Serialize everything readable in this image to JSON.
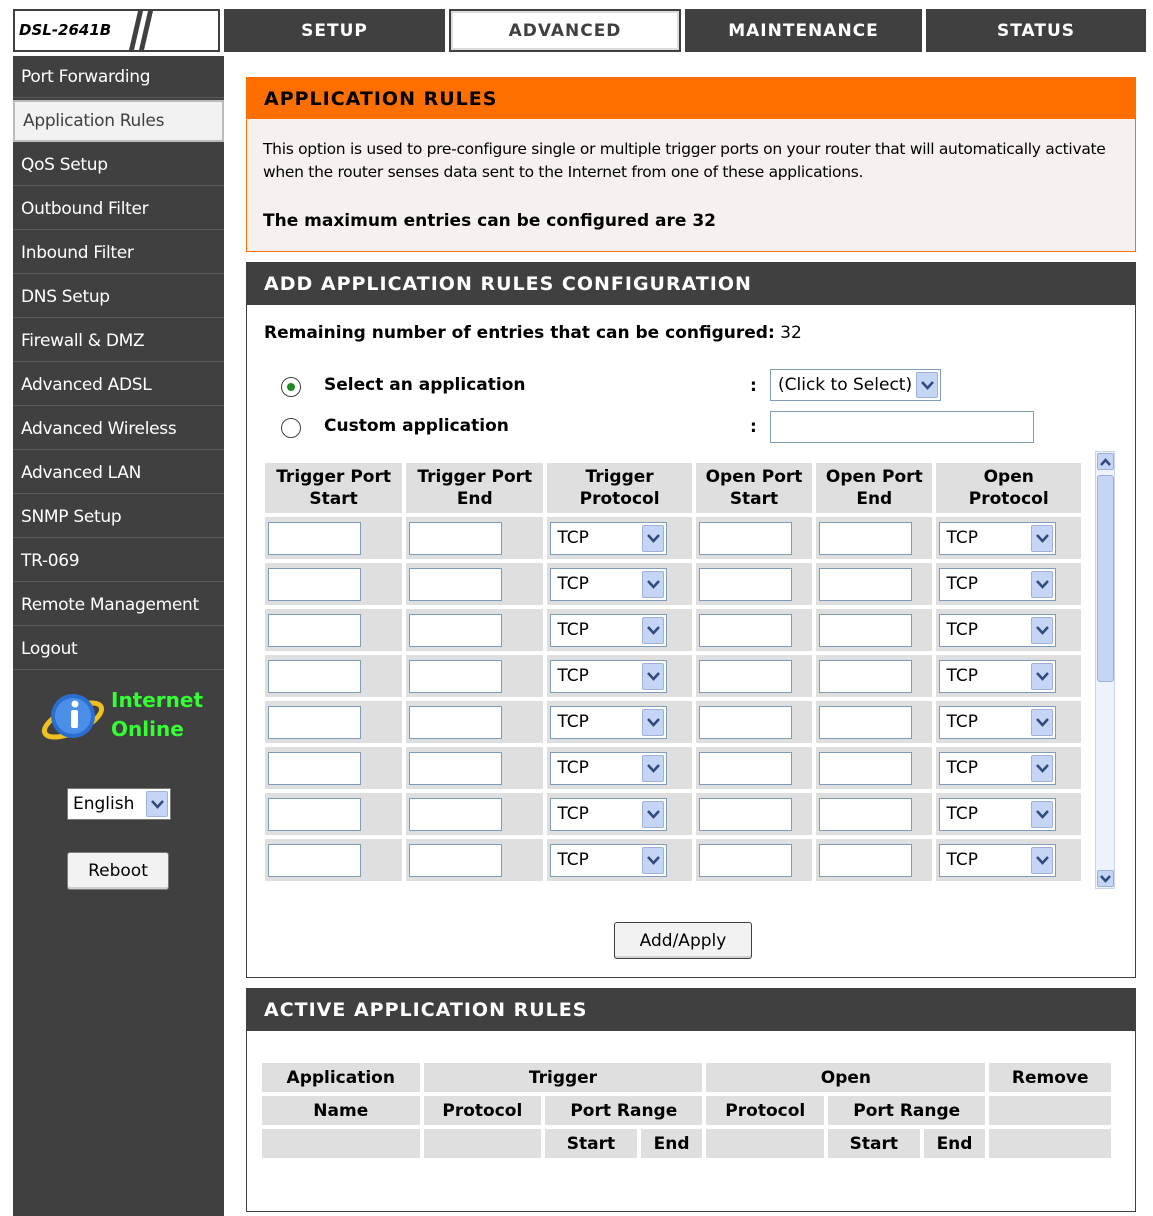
{
  "model": "DSL-2641B",
  "tabs": [
    "SETUP",
    "ADVANCED",
    "MAINTENANCE",
    "STATUS"
  ],
  "active_tab": "ADVANCED",
  "sidebar": {
    "items": [
      "Port Forwarding",
      "Application Rules",
      "QoS Setup",
      "Outbound Filter",
      "Inbound Filter",
      "DNS Setup",
      "Firewall & DMZ",
      "Advanced ADSL",
      "Advanced Wireless",
      "Advanced LAN",
      "SNMP Setup",
      "TR-069",
      "Remote Management",
      "Logout"
    ],
    "active": "Application Rules",
    "status_line1": "Internet",
    "status_line2": "Online",
    "language": "English",
    "reboot": "Reboot"
  },
  "app_rules": {
    "title": "APPLICATION RULES",
    "description": "This option is used to pre-configure single or multiple trigger ports on your router that will automatically activate when the router senses data sent to the Internet from one of these applications.",
    "max_entries": "The maximum entries can be configured are 32"
  },
  "add_config": {
    "title": "ADD APPLICATION RULES CONFIGURATION",
    "remaining_label": "Remaining number of entries that can be configured:",
    "remaining_value": "32",
    "select_app_label": "Select an application",
    "custom_app_label": "Custom application",
    "colon": ":",
    "select_placeholder": "(Click to Select)",
    "headers": [
      [
        "Trigger Port",
        "Start"
      ],
      [
        "Trigger Port",
        "End"
      ],
      [
        "Trigger",
        "Protocol"
      ],
      [
        "Open Port",
        "Start"
      ],
      [
        "Open Port",
        "End"
      ],
      [
        "Open",
        "Protocol"
      ]
    ],
    "protocol_value": "TCP",
    "rows_visible": 8,
    "apply": "Add/Apply"
  },
  "active_rules": {
    "title": "ACTIVE APPLICATION RULES",
    "h_application": "Application",
    "h_trigger": "Trigger",
    "h_open": "Open",
    "h_remove": "Remove",
    "h_name": "Name",
    "h_protocol": "Protocol",
    "h_port_range": "Port Range",
    "h_start": "Start",
    "h_end": "End"
  }
}
